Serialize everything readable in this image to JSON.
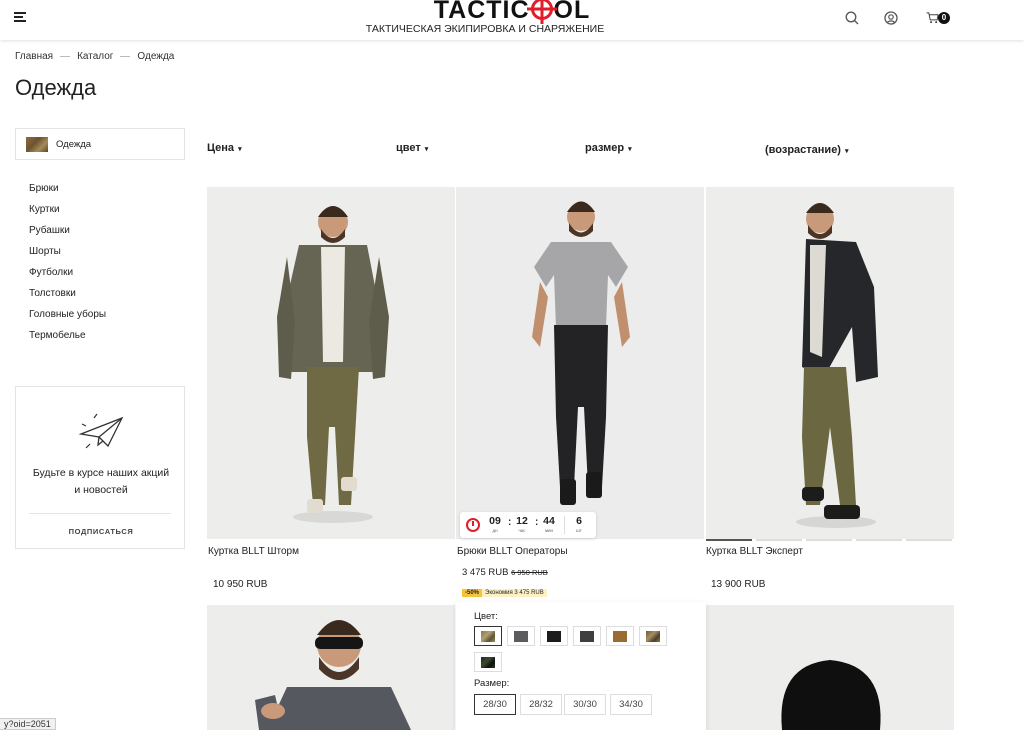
{
  "header": {
    "logo_text_left": "TACTIC",
    "logo_text_right": "OL",
    "tagline": "ТАКТИЧЕСКАЯ ЭКИПИРОВКА И СНАРЯЖЕНИЕ",
    "cart_count": "0",
    "accent_color": "#e11d2a"
  },
  "breadcrumb": [
    "Главная",
    "Каталог",
    "Одежда"
  ],
  "page_title": "Одежда",
  "sidebar": {
    "category_label": "Одежда",
    "items": [
      "Брюки",
      "Куртки",
      "Рубашки",
      "Шорты",
      "Футболки",
      "Толстовки",
      "Головные уборы",
      "Термобелье"
    ],
    "subscribe_text_1": "Будьте в курсе наших акций",
    "subscribe_text_2": "и новостей",
    "subscribe_button": "ПОДПИСАТЬСЯ"
  },
  "filters": [
    "Цена",
    "цвет",
    "размер",
    "(возрастание)"
  ],
  "products": [
    {
      "name": "Куртка BLLT Шторм",
      "price": "10 950 RUB"
    },
    {
      "name": "Брюки BLLT Операторы",
      "price": "3 475 RUB",
      "old_price": "6 950 RUB",
      "discount": "-50%",
      "savings": "Экономия 3 475 RUB"
    },
    {
      "name": "Куртка BLLT Эксперт",
      "price": "13 900 RUB"
    }
  ],
  "timer": {
    "days": "09",
    "days_label": "дн",
    "hours": "12",
    "hours_label": "час",
    "minutes": "44",
    "minutes_label": "мин",
    "count": "6",
    "count_label": "шт"
  },
  "options": {
    "color_label": "Цвет:",
    "colors": [
      "#8a7a4e",
      "#5c5c5e",
      "#1c1c1c",
      "#3f3f3f",
      "#9b6b34",
      "#6f5a3b",
      "#1f2c1e"
    ],
    "size_label": "Размер:",
    "sizes": [
      "28/30",
      "28/32",
      "30/30",
      "34/30"
    ]
  },
  "status_url": "y?oid=2051"
}
